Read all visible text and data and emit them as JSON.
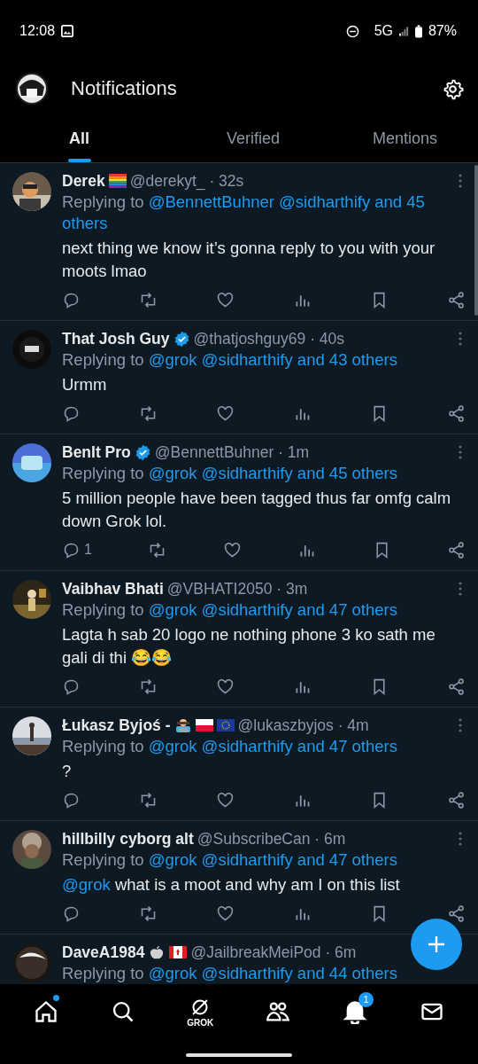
{
  "status_bar": {
    "time": "12:08",
    "network": "5G",
    "battery": "87%"
  },
  "header": {
    "title": "Notifications"
  },
  "tabs": [
    {
      "label": "All",
      "selected": true
    },
    {
      "label": "Verified",
      "selected": false
    },
    {
      "label": "Mentions",
      "selected": false
    }
  ],
  "tweets": [
    {
      "name": "Derek",
      "name_badges": [
        {
          "kind": "rainbow-flag"
        }
      ],
      "verified": false,
      "meta": "@derekyt_ · 32s",
      "reply_label": "Replying to",
      "reply_to": "@BennettBuhner @sidharthify and 45 others",
      "body": "next thing we know it’s gonna reply to you with your moots lmao"
    },
    {
      "name": "That Josh Guy",
      "verified": true,
      "meta": "@thatjoshguy69 · 40s",
      "reply_label": "Replying to",
      "reply_to": "@grok @sidharthify and 43 others",
      "body": "Urmm"
    },
    {
      "name": "BenIt Pro",
      "verified": true,
      "meta": "@BennettBuhner · 1m",
      "reply_label": "Replying to",
      "reply_to": "@grok @sidharthify and 45 others",
      "body": "5 million people have been tagged thus far omfg calm down Grok lol.",
      "reply_count": "1"
    },
    {
      "name": "Vaibhav Bhati",
      "verified": false,
      "meta": "@VBHATI2050 · 3m",
      "reply_label": "Replying to",
      "reply_to": "@grok @sidharthify and 47 others",
      "body": "Lagta h sab 20 logo ne nothing phone 3 ko sath me gali di thi 😂😂"
    },
    {
      "name": "Łukasz Byjoś -",
      "name_badges": [
        {
          "kind": "technologist"
        },
        {
          "kind": "poland-flag"
        },
        {
          "kind": "eu-flag"
        }
      ],
      "verified": false,
      "meta": "@lukaszbyjos · 4m",
      "reply_label": "Replying to",
      "reply_to": "@grok @sidharthify and 47 others",
      "body": "?"
    },
    {
      "name": "hillbilly cyborg alt",
      "verified": false,
      "meta": "@SubscribeCan · 6m",
      "reply_label": "Replying to",
      "reply_to": "@grok @sidharthify and 47 others",
      "body_mention": "@grok",
      "body": "what is a moot and why am I on this list"
    },
    {
      "name": "DaveA1984",
      "name_badges": [
        {
          "kind": "apple"
        },
        {
          "kind": "canada-flag"
        }
      ],
      "verified": false,
      "meta": "@JailbreakMeiPod · 6m",
      "reply_label": "Replying to",
      "reply_to": "@grok @sidharthify and 44 others",
      "more_menu": false
    }
  ],
  "nav": [
    {
      "kind": "home",
      "dot": true,
      "selected": false
    },
    {
      "kind": "search",
      "selected": false
    },
    {
      "kind": "grok",
      "label": "GROK",
      "selected": false
    },
    {
      "kind": "communities",
      "selected": false
    },
    {
      "kind": "bell",
      "badge": "1",
      "selected": true
    },
    {
      "kind": "mail",
      "selected": false
    }
  ]
}
